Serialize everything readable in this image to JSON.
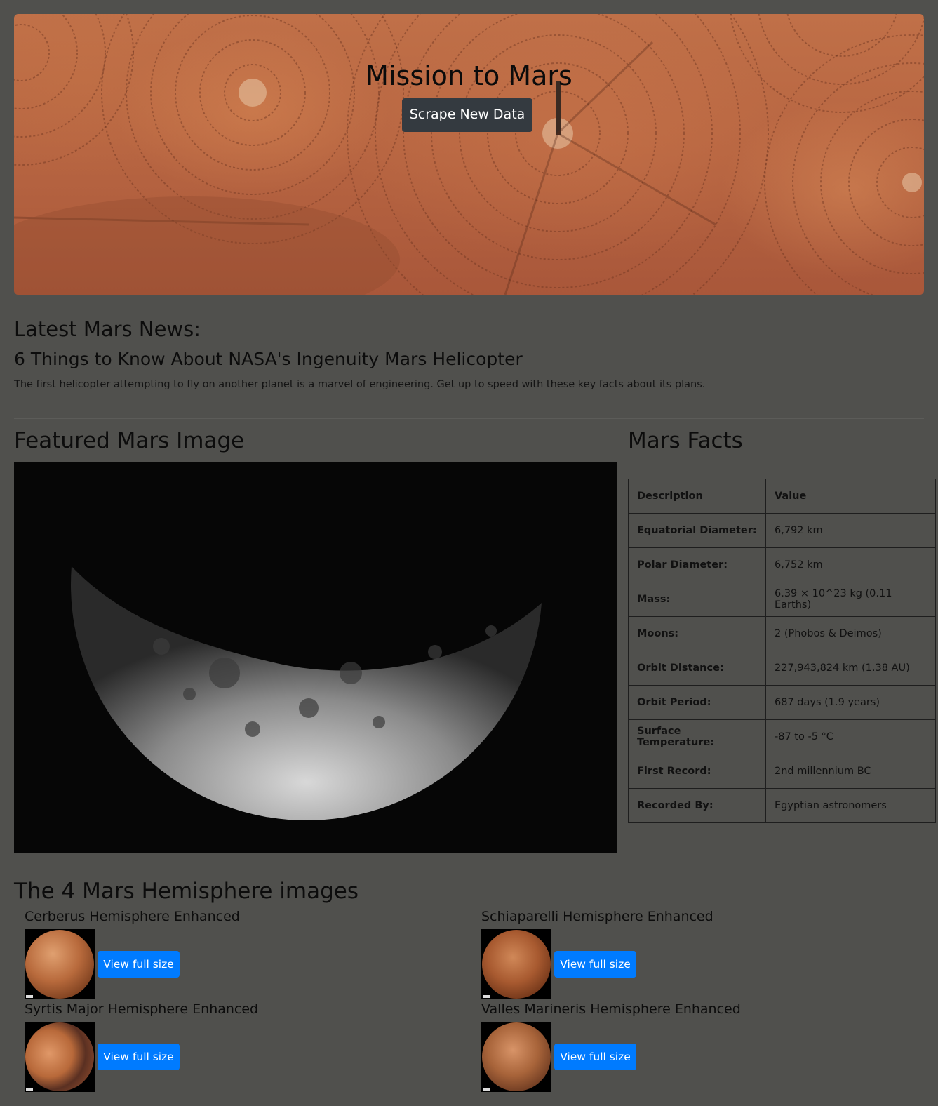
{
  "header": {
    "title": "Mission to Mars",
    "scrape_button": "Scrape New Data"
  },
  "news": {
    "heading": "Latest Mars News:",
    "title": "6 Things to Know About NASA's Ingenuity Mars Helicopter",
    "teaser": "The first helicopter attempting to fly on another planet is a marvel of engineering. Get up to speed with these key facts about its plans."
  },
  "featured": {
    "heading": "Featured Mars Image"
  },
  "facts": {
    "heading": "Mars Facts",
    "header": {
      "key": "Description",
      "value": "Value"
    },
    "rows": [
      {
        "key": "Equatorial Diameter:",
        "value": "6,792 km"
      },
      {
        "key": "Polar Diameter:",
        "value": "6,752 km"
      },
      {
        "key": "Mass:",
        "value": "6.39 × 10^23 kg (0.11 Earths)"
      },
      {
        "key": "Moons:",
        "value": "2 (Phobos & Deimos)"
      },
      {
        "key": "Orbit Distance:",
        "value": "227,943,824 km (1.38 AU)"
      },
      {
        "key": "Orbit Period:",
        "value": "687 days (1.9 years)"
      },
      {
        "key": "Surface Temperature:",
        "value": "-87 to -5 °C"
      },
      {
        "key": "First Record:",
        "value": "2nd millennium BC"
      },
      {
        "key": "Recorded By:",
        "value": "Egyptian astronomers"
      }
    ]
  },
  "hemispheres": {
    "heading": "The 4 Mars Hemisphere images",
    "items": [
      {
        "title": "Cerberus Hemisphere Enhanced",
        "button": "View full size"
      },
      {
        "title": "Schiaparelli Hemisphere Enhanced",
        "button": "View full size"
      },
      {
        "title": "Syrtis Major Hemisphere Enhanced",
        "button": "View full size"
      },
      {
        "title": "Valles Marineris Hemisphere Enhanced",
        "button": "View full size"
      }
    ]
  }
}
